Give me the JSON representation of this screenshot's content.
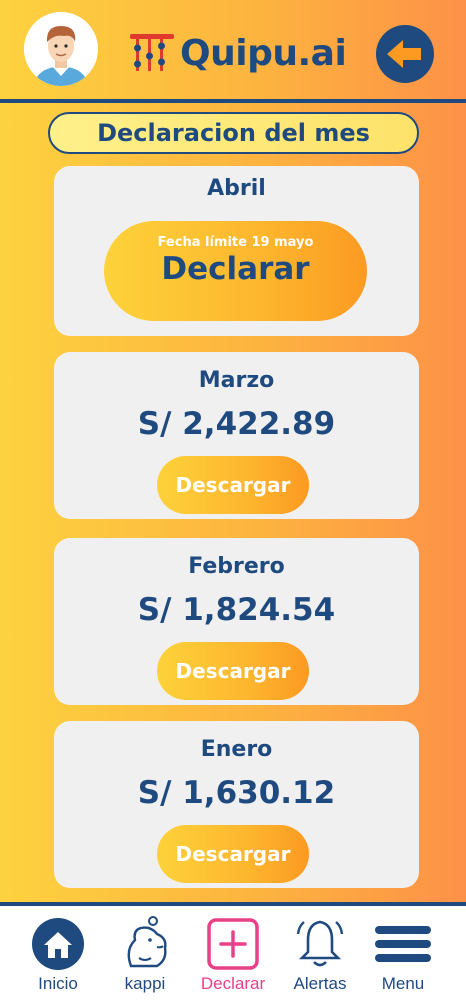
{
  "header": {
    "app_name": "Quipu.ai",
    "colors": {
      "brand_blue": "#1f4a80",
      "orange": "#fc9a22",
      "pink": "#e8408a"
    }
  },
  "section": {
    "title": "Declaracion del mes"
  },
  "current": {
    "month": "Abril",
    "deadline": "Fecha límite 19 mayo",
    "action_label": "Declarar"
  },
  "history": [
    {
      "month": "Marzo",
      "amount": "S/ 2,422.89",
      "button": "Descargar"
    },
    {
      "month": "Febrero",
      "amount": "S/ 1,824.54",
      "button": "Descargar"
    },
    {
      "month": "Enero",
      "amount": "S/ 1,630.12",
      "button": "Descargar"
    }
  ],
  "nav": {
    "items": [
      {
        "label": "Inicio",
        "icon": "home-icon"
      },
      {
        "label": "kappi",
        "icon": "capybara-icon"
      },
      {
        "label": "Declarar",
        "icon": "plus-icon",
        "active": true
      },
      {
        "label": "Alertas",
        "icon": "bell-icon"
      },
      {
        "label": "Menu",
        "icon": "menu-icon"
      }
    ]
  }
}
